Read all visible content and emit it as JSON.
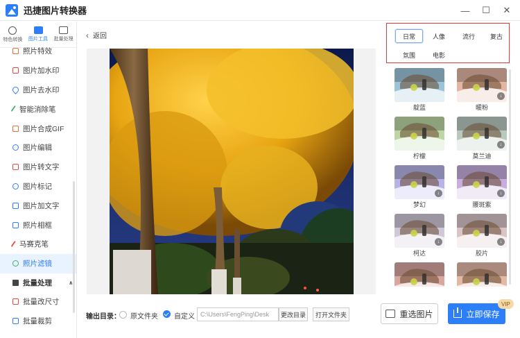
{
  "app": {
    "title": "迅捷图片转换器"
  },
  "window_controls": {
    "minimize": "—",
    "maximize": "☐",
    "close": "✕"
  },
  "sidebar": {
    "tabs": [
      {
        "label": "特色转换"
      },
      {
        "label": "图片工具"
      },
      {
        "label": "批量处理"
      }
    ],
    "partial_item": "照片特效",
    "items": [
      {
        "label": "图片加水印",
        "icon": "watermark-add-icon"
      },
      {
        "label": "图片去水印",
        "icon": "watermark-remove-icon"
      },
      {
        "label": "智能消除笔",
        "icon": "eraser-pen-icon"
      },
      {
        "label": "图片合成GIF",
        "icon": "gif-icon"
      },
      {
        "label": "图片编辑",
        "icon": "edit-icon"
      },
      {
        "label": "图片转文字",
        "icon": "text-icon"
      },
      {
        "label": "图片标记",
        "icon": "mark-icon"
      },
      {
        "label": "图片加文字",
        "icon": "add-text-icon"
      },
      {
        "label": "照片相框",
        "icon": "frame-icon"
      },
      {
        "label": "马赛克笔",
        "icon": "mosaic-icon"
      },
      {
        "label": "照片滤镜",
        "icon": "filter-icon"
      }
    ],
    "section": {
      "label": "批量处理",
      "chevron": "∧"
    },
    "section_items": [
      {
        "label": "批量改尺寸",
        "icon": "resize-icon"
      },
      {
        "label": "批量裁剪",
        "icon": "crop-icon"
      }
    ]
  },
  "main": {
    "back_label": "返回",
    "back_icon": "‹"
  },
  "bottom": {
    "output_label": "输出目录：",
    "option_source": "原文件夹",
    "option_custom": "自定义",
    "path_value": "C:\\Users\\FengPing\\Desk",
    "change_dir": "更改目录",
    "open_folder": "打开文件夹",
    "reselect": "重选图片",
    "save": "立即保存",
    "vip": "VIP"
  },
  "categories": [
    "日常",
    "人像",
    "流行",
    "复古",
    "氛围",
    "电影"
  ],
  "active_category": "日常",
  "filters": [
    {
      "name": "靛蓝",
      "tint": "#9cc4d8",
      "download": false
    },
    {
      "name": "暖粉",
      "tint": "#e3b6a4",
      "download": true
    },
    {
      "name": "柠檬",
      "tint": "#bcd7a6",
      "download": false
    },
    {
      "name": "莫兰迪",
      "tint": "#b9c9c0",
      "download": true
    },
    {
      "name": "梦幻",
      "tint": "#b8b4ea",
      "download": true
    },
    {
      "name": "腰斑紫",
      "tint": "#c7aedf",
      "download": true
    },
    {
      "name": "柯达",
      "tint": "#cfc8d8",
      "download": true
    },
    {
      "name": "胶片",
      "tint": "#d9c4c8",
      "download": true
    },
    {
      "name": "",
      "tint": "#d9a6a0",
      "download": false
    },
    {
      "name": "",
      "tint": "#e3b9a6",
      "download": false
    }
  ],
  "colors": {
    "accent": "#2d7ff9",
    "highlight_border": "#e53935",
    "tree_gold": "#f0b21c",
    "sky": "#1a2b5a"
  }
}
